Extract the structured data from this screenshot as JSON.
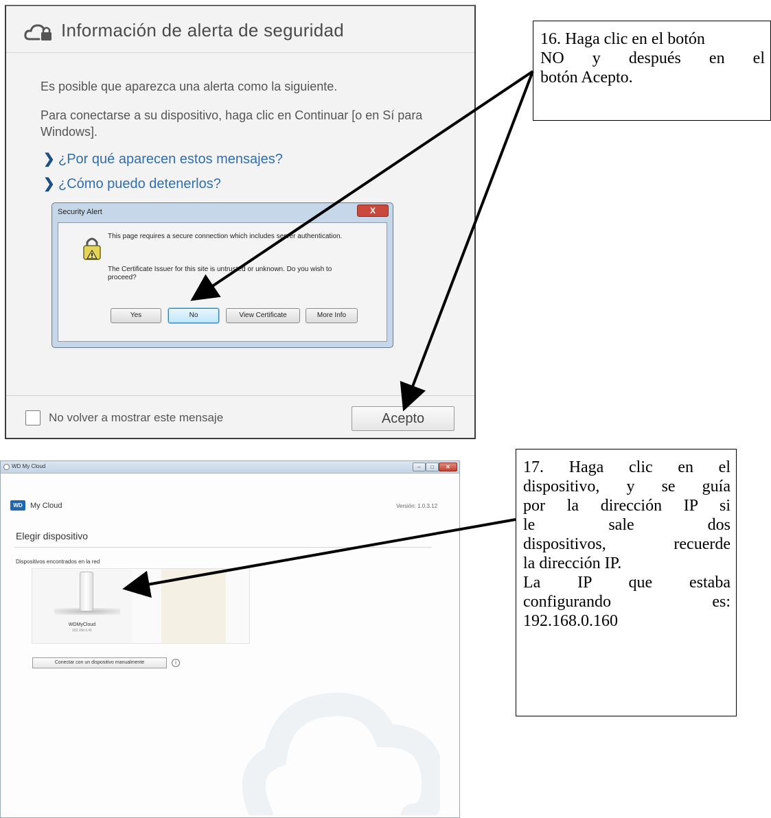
{
  "alert_dialog": {
    "title": "Información de alerta de seguridad",
    "line1": "Es posible que aparezca una alerta como la siguiente.",
    "line2": "Para conectarse a su dispositivo, haga clic en Continuar [o en Sí para Windows].",
    "link1": "¿Por qué aparecen estos mensajes?",
    "link2": "¿Cómo puedo detenerlos?",
    "checkbox_label": "No volver a mostrar este mensaje",
    "accept_button": "Acepto",
    "security_alert": {
      "title": "Security Alert",
      "close_glyph": "X",
      "text1": "This page requires a secure connection which includes server authentication.",
      "text2": "The Certificate Issuer for this site is untrusted or unknown.  Do you wish to proceed?",
      "buttons": {
        "yes": "Yes",
        "no": "No",
        "view_certificate": "View Certificate",
        "more_info": "More Info"
      }
    }
  },
  "app_window": {
    "window_title": "WD My Cloud",
    "controls": {
      "minimize": "–",
      "maximize": "□",
      "close": "✕"
    },
    "logo": "WD",
    "brand": "My Cloud",
    "version": "Versión: 1.0.3.12",
    "heading": "Elegir dispositivo",
    "devices_label": "Dispositivos encontrados en la red",
    "device_name": "WDMyCloud",
    "device_ip": "192.168.0.41",
    "manual_button": "Conectar con un dispositivo manualmente",
    "info_glyph": "i"
  },
  "callout_16": {
    "lines": [
      "16. Haga clic en el botón",
      "NO y después en el",
      "botón Acepto."
    ]
  },
  "callout_17": {
    "lines": [
      "17. Haga clic en el",
      "dispositivo, y se guía",
      "por la dirección IP si",
      "le sale dos",
      "dispositivos, recuerde",
      "la dirección IP.",
      "La IP que estaba",
      "configurando es:",
      "192.168.0.160"
    ]
  },
  "colors": {
    "link": "#2f6fae",
    "wd_blue": "#1f67b0",
    "close_red": "#c4412f",
    "arrow": "#000000"
  },
  "icons": [
    "cloud-lock-icon",
    "chevron-right-icon",
    "warning-lock-icon",
    "close-icon",
    "checkbox-icon",
    "info-icon",
    "device-icon",
    "cloud-watermark-icon"
  ]
}
